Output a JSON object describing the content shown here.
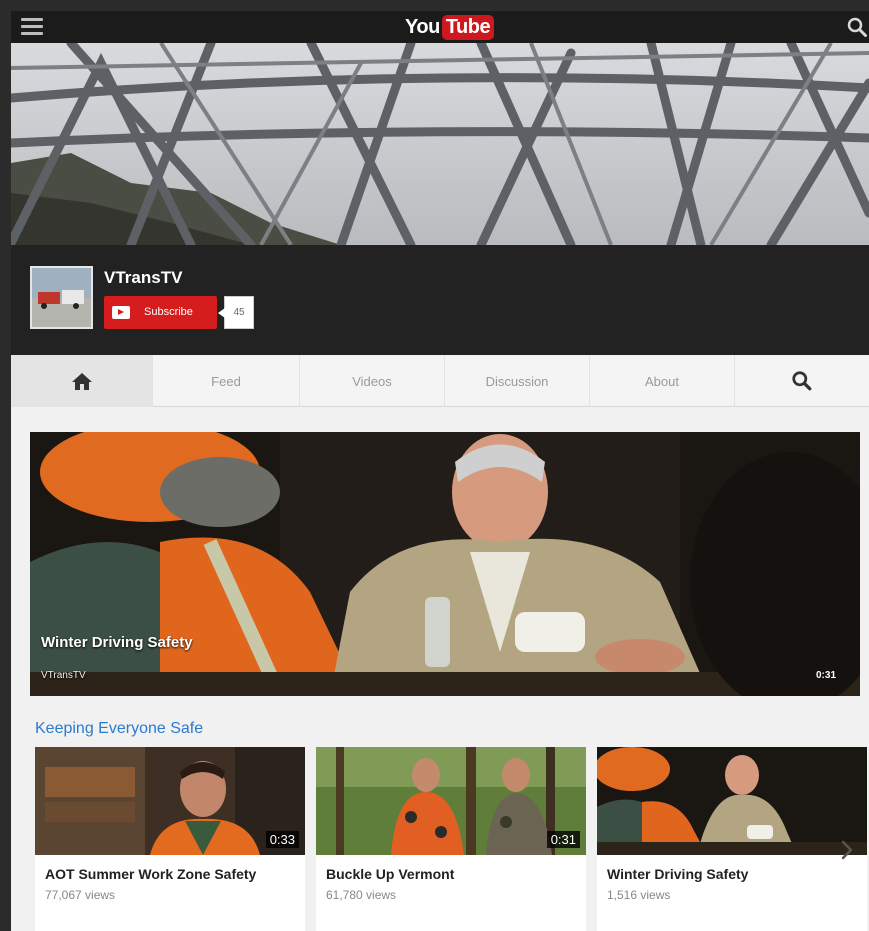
{
  "top_bar": {
    "logo_you": "You",
    "logo_tube": "Tube",
    "menu_icon": "hamburger-menu-icon",
    "search_icon": "search-icon"
  },
  "channel": {
    "name": "VTransTV",
    "subscribe_label": "Subscribe",
    "subscriber_count": "45",
    "subscribe_color": "#d51d1d"
  },
  "tabs": [
    {
      "label": "",
      "icon": "home-icon",
      "active": true
    },
    {
      "label": "Feed"
    },
    {
      "label": "Videos"
    },
    {
      "label": "Discussion"
    },
    {
      "label": "About"
    },
    {
      "label": "",
      "icon": "search-icon"
    }
  ],
  "featured": {
    "title": "Winter Driving Safety",
    "channel": "VTransTV",
    "duration": "0:31"
  },
  "shelf": {
    "title": "Keeping Everyone Safe",
    "title_color": "#2a7ad0",
    "videos": [
      {
        "title": "AOT Summer Work Zone Safety",
        "views": "77,067 views",
        "duration": "0:33"
      },
      {
        "title": "Buckle Up Vermont",
        "views": "61,780 views",
        "duration": "0:31"
      },
      {
        "title": "Winter Driving Safety",
        "views": "1,516 views",
        "duration": ""
      }
    ],
    "next_icon": "chevron-right-icon"
  }
}
